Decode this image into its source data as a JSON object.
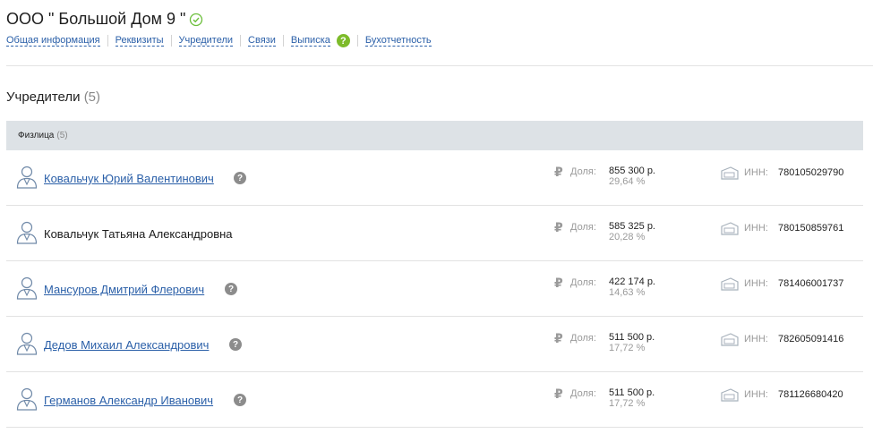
{
  "company": {
    "title": "ООО \" Большой Дом 9 \""
  },
  "nav": {
    "items": [
      "Общая информация",
      "Реквизиты",
      "Учредители",
      "Связи",
      "Выписка",
      "Бухотчетность"
    ],
    "help": "?"
  },
  "section": {
    "title": "Учредители",
    "count": "(5)"
  },
  "group": {
    "label": "Физлица",
    "count": "(5)"
  },
  "labels": {
    "share": "Доля:",
    "inn": "ИНН:",
    "question": "?"
  },
  "founders": [
    {
      "name": "Ковальчук Юрий Валентинович",
      "link": true,
      "help": true,
      "amount": "855 300 р.",
      "pct": "29,64 %",
      "inn": "780105029790"
    },
    {
      "name": "Ковальчук Татьяна Александровна",
      "link": false,
      "help": false,
      "amount": "585 325 р.",
      "pct": "20,28 %",
      "inn": "780150859761"
    },
    {
      "name": "Мансуров Дмитрий Флерович",
      "link": true,
      "help": true,
      "amount": "422 174 р.",
      "pct": "14,63 %",
      "inn": "781406001737"
    },
    {
      "name": "Дедов Михаил Александрович",
      "link": true,
      "help": true,
      "amount": "511 500 р.",
      "pct": "17,72 %",
      "inn": "782605091416"
    },
    {
      "name": "Германов Александр Иванович",
      "link": true,
      "help": true,
      "amount": "511 500 р.",
      "pct": "17,72 %",
      "inn": "781126680420"
    }
  ]
}
